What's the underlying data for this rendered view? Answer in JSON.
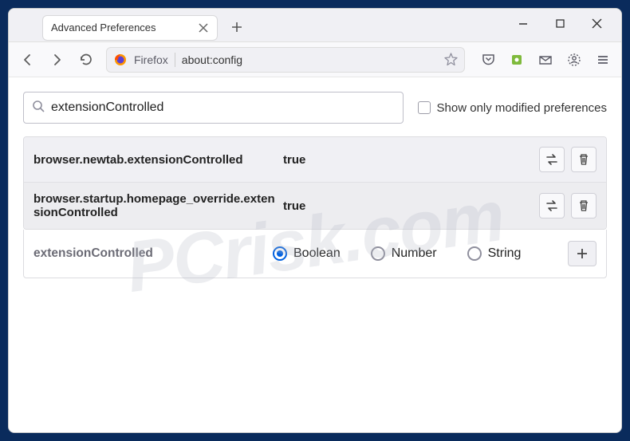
{
  "tab": {
    "title": "Advanced Preferences"
  },
  "urlbar": {
    "firefox_label": "Firefox",
    "url": "about:config"
  },
  "search": {
    "value": "extensionControlled"
  },
  "filter": {
    "show_modified_label": "Show only modified preferences"
  },
  "prefs": [
    {
      "name": "browser.newtab.extensionControlled",
      "value": "true"
    },
    {
      "name": "browser.startup.homepage_override.extensionControlled",
      "value": "true"
    }
  ],
  "add": {
    "name": "extensionControlled",
    "types": {
      "boolean": "Boolean",
      "number": "Number",
      "string": "String"
    },
    "selected": "boolean"
  },
  "watermark": "PCrisk.com"
}
